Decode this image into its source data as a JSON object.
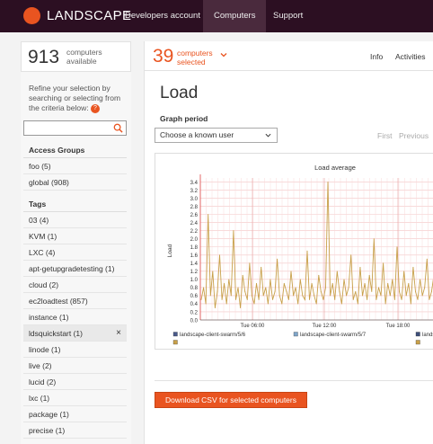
{
  "nav": {
    "logo_text": "LANDSCAPE",
    "items": [
      "Developers account",
      "Computers",
      "Support"
    ],
    "active_item": "Computers"
  },
  "sidebar": {
    "computers_count": "913",
    "computers_label": "computers available",
    "refine_text": "Refine your selection by searching or selecting from the criteria below:",
    "help_glyph": "?",
    "search_value": "",
    "access_groups_header": "Access Groups",
    "access_groups": [
      "foo (5)",
      "global (908)"
    ],
    "tags_header": "Tags",
    "tags": [
      "03 (4)",
      "KVM (1)",
      "LXC (4)",
      "apt-getupgradetesting (1)",
      "cloud (2)",
      "ec2loadtest (857)",
      "instance (1)",
      "ldsquickstart (1)",
      "linode (1)",
      "live (2)",
      "lucid (2)",
      "lxc (1)",
      "package (1)",
      "precise (1)"
    ],
    "selected_tag": "ldsquickstart (1)",
    "remove_glyph": "×"
  },
  "main": {
    "selected_count": "39",
    "selected_label": "computers selected",
    "tabs": [
      "Info",
      "Activities"
    ],
    "page_title": "Load",
    "graph_period_label": "Graph period",
    "graph_period_select": "Choose a known user",
    "pager": [
      "First",
      "Previous"
    ],
    "csv_button": "Download CSV for selected computers"
  },
  "colors": {
    "brand": "#e95420",
    "nav_bg": "#2c0f22",
    "series_main": "#c8a04a"
  },
  "chart_data": {
    "type": "line",
    "title": "Load average",
    "ylabel": "Load",
    "xlabel": "",
    "ylim": [
      0,
      3.5
    ],
    "yticks": [
      "0.0",
      "0.2",
      "0.4",
      "0.6",
      "0.8",
      "1.0",
      "1.2",
      "1.4",
      "1.6",
      "1.8",
      "2.0",
      "2.2",
      "2.4",
      "2.6",
      "2.8",
      "3.0",
      "3.2",
      "3.4"
    ],
    "xticks": [
      "Tue 06:00",
      "Tue 12:00",
      "Tue 18:00"
    ],
    "grid": true,
    "legend": [
      {
        "name": "landscape-client-swarm/5/6",
        "color": "#4a5a8a"
      },
      {
        "name": "landscape-client-swarm/5/7",
        "color": "#7fa6c9"
      },
      {
        "name": "landscape-client-swarm/5/9",
        "color": "#3e4f7a"
      },
      {
        "name": "",
        "color": "#c8a04a"
      },
      {
        "name": "",
        "color": "#c8a04a"
      }
    ],
    "series": [
      {
        "name": "landscape-client-swarm/5/6",
        "color": "#c8a04a",
        "values": [
          0.5,
          0.8,
          0.4,
          2.6,
          0.6,
          1.2,
          0.3,
          0.7,
          1.6,
          0.5,
          0.9,
          0.4,
          1.0,
          0.6,
          2.2,
          0.5,
          0.8,
          0.3,
          1.1,
          0.7,
          0.5,
          1.4,
          0.6,
          0.4,
          0.9,
          0.5,
          1.3,
          0.6,
          0.8,
          0.4,
          1.0,
          0.5,
          0.7,
          1.5,
          0.6,
          0.4,
          0.9,
          0.7,
          0.5,
          1.2,
          0.6,
          0.8,
          0.4,
          1.0,
          0.6,
          0.5,
          1.7,
          0.5,
          0.9,
          0.6,
          0.4,
          1.1,
          0.7,
          0.5,
          0.8,
          3.4,
          0.6,
          0.9,
          0.5,
          1.2,
          0.7,
          0.4,
          1.0,
          0.6,
          0.8,
          1.6,
          0.5,
          0.7,
          0.4,
          1.3,
          0.6,
          0.9,
          0.5,
          1.1,
          0.7,
          2.0,
          0.5,
          0.8,
          0.6,
          1.4,
          0.4,
          0.9,
          0.6,
          1.0,
          0.5,
          1.8,
          0.7,
          0.5,
          1.2,
          0.6,
          0.9,
          0.4,
          1.3,
          0.7,
          0.5,
          1.0,
          0.6,
          0.8,
          1.5,
          0.5,
          0.7,
          1.1
        ]
      }
    ]
  }
}
